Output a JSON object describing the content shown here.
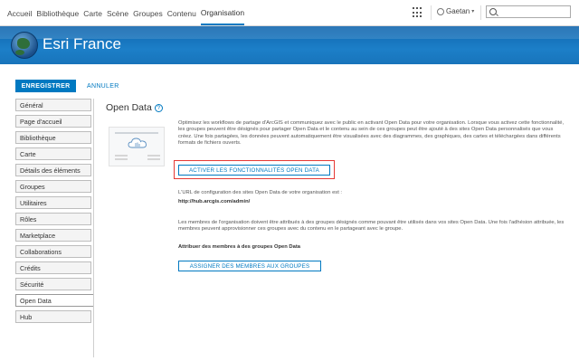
{
  "nav": {
    "items": [
      "Accueil",
      "Bibliothèque",
      "Carte",
      "Scène",
      "Groupes",
      "Contenu",
      "Organisation"
    ],
    "active": "Organisation",
    "user": "Gaetan"
  },
  "banner": {
    "title": "Esri France"
  },
  "toolbar": {
    "save_label": "ENREGISTRER",
    "cancel_label": "ANNULER"
  },
  "sidebar": {
    "items": [
      {
        "label": "Général"
      },
      {
        "label": "Page d'accueil"
      },
      {
        "label": "Bibliothèque"
      },
      {
        "label": "Carte"
      },
      {
        "label": "Détails des éléments"
      },
      {
        "label": "Groupes"
      },
      {
        "label": "Utilitaires"
      },
      {
        "label": "Rôles"
      },
      {
        "label": "Marketplace"
      },
      {
        "label": "Collaborations"
      },
      {
        "label": "Crédits"
      },
      {
        "label": "Sécurité"
      },
      {
        "label": "Open Data"
      },
      {
        "label": "Hub"
      }
    ],
    "active": "Open Data"
  },
  "main": {
    "title": "Open Data",
    "description": "Optimisez les workflows de partage d'ArcGIS et communiquez avec le public en activant Open Data pour votre organisation. Lorsque vous activez cette fonctionnalité, les groupes peuvent être désignés pour partager Open Data et le contenu au sein de ces groupes peut être ajouté à des sites Open Data personnalisés que vous créez. Une fois partagées, les données peuvent automatiquement être visualisées avec des diagrammes, des graphiques, des cartes et téléchargées dans différents formats de fichiers ouverts.",
    "activate_label": "ACTIVER LES FONCTIONNALITÉS OPEN DATA",
    "url_label": "L'URL de configuration des sites Open Data de votre organisation est :",
    "url": "http://hub.arcgis.com/admin/",
    "members_text": "Les membres de l'organisation doivent être attribués à des groupes désignés comme pouvant être utilisés dans vos sites Open Data. Une fois l'adhésion attribuée, les membres peuvent approvisionner ces groupes avec du contenu en le partageant avec le groupe.",
    "assign_title": "Attribuer des membres à des groupes Open Data",
    "assign_label": "ASSIGNER DES MEMBRES AUX GROUPES"
  },
  "colors": {
    "accent": "#0079c1",
    "highlight": "#e53935",
    "banner": "#1874bb"
  }
}
